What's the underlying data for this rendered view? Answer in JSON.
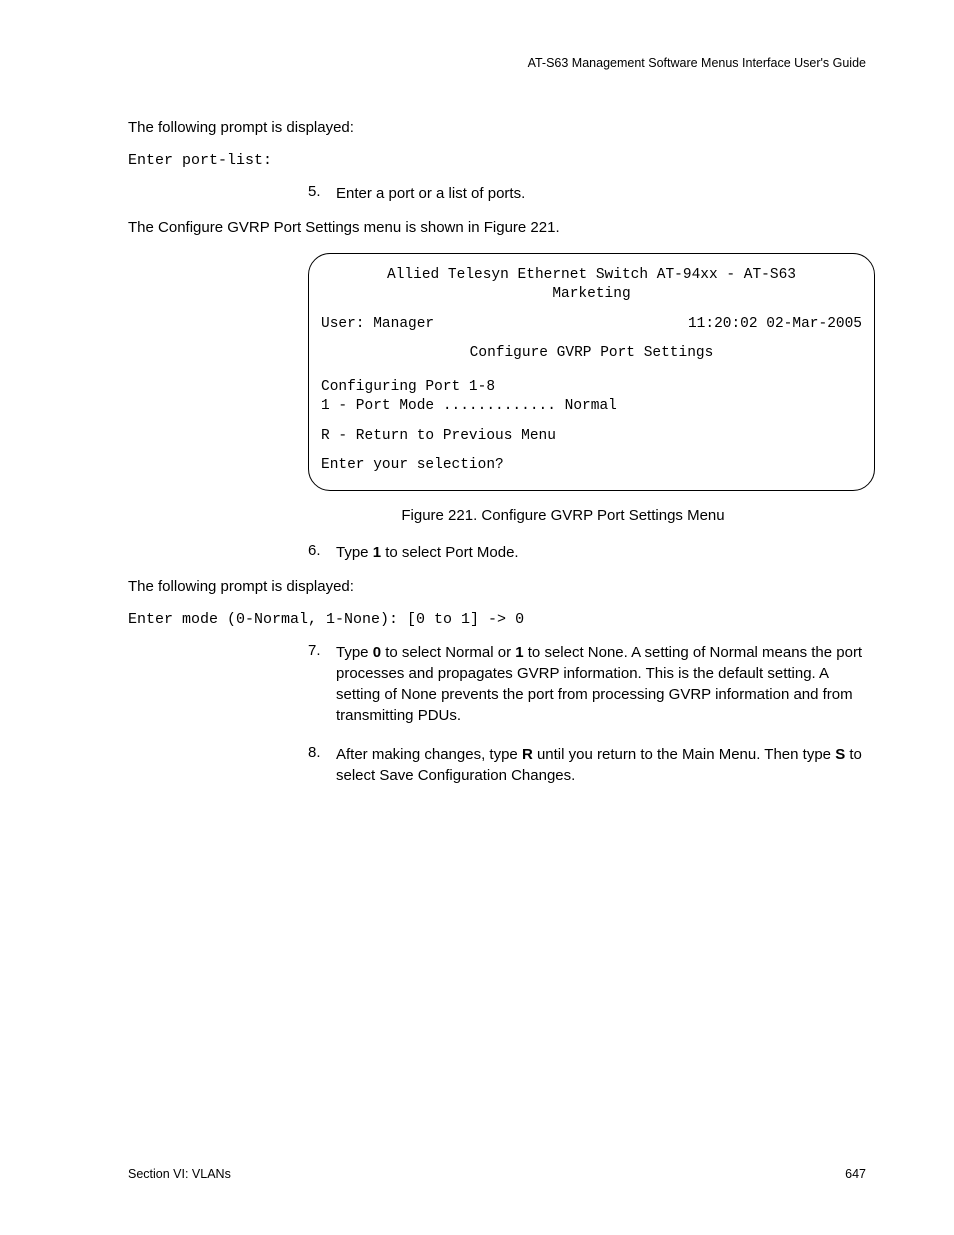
{
  "header": {
    "title": "AT-S63 Management Software Menus Interface User's Guide"
  },
  "content": {
    "intro_para": "The following prompt is displayed:",
    "intro_mono": "Enter port-list:",
    "steps": {
      "s5": {
        "num": "5.",
        "text": "Enter a port or a list of ports.",
        "after": "The Configure GVRP Port Settings menu is shown in Figure 221."
      },
      "s6": {
        "num": "6.",
        "pre": "Type ",
        "bold1": "1",
        "post": " to select Port Mode.",
        "after_para": "The following prompt is displayed:",
        "after_mono": "Enter mode (0-Normal, 1-None): [0 to 1] -> 0"
      },
      "s7": {
        "num": "7.",
        "p1": "Type ",
        "b1": "0",
        "p2": " to select Normal or ",
        "b2": "1",
        "p3": " to select None. A setting of Normal means the port processes and propagates GVRP information. This is the default setting. A setting of None prevents the port from processing GVRP information and from transmitting PDUs."
      },
      "s8": {
        "num": "8.",
        "p1": "After making changes, type ",
        "b1": "R",
        "p2": " until you return to the Main Menu. Then type ",
        "b2": "S",
        "p3": " to select Save Configuration Changes."
      }
    },
    "figure_caption": "Figure 221. Configure GVRP Port Settings Menu"
  },
  "terminal": {
    "title1": "Allied Telesyn Ethernet Switch AT-94xx - AT-S63",
    "title2": "Marketing",
    "user": "User: Manager",
    "timestamp": "11:20:02 02-Mar-2005",
    "menu_title": "Configure GVRP Port Settings",
    "conf_line": "Configuring Port 1-8",
    "opt1": "1 - Port Mode ............. Normal",
    "return": "R - Return to Previous Menu",
    "prompt": "Enter your selection?"
  },
  "footer": {
    "left": "Section VI: VLANs",
    "right": "647"
  }
}
